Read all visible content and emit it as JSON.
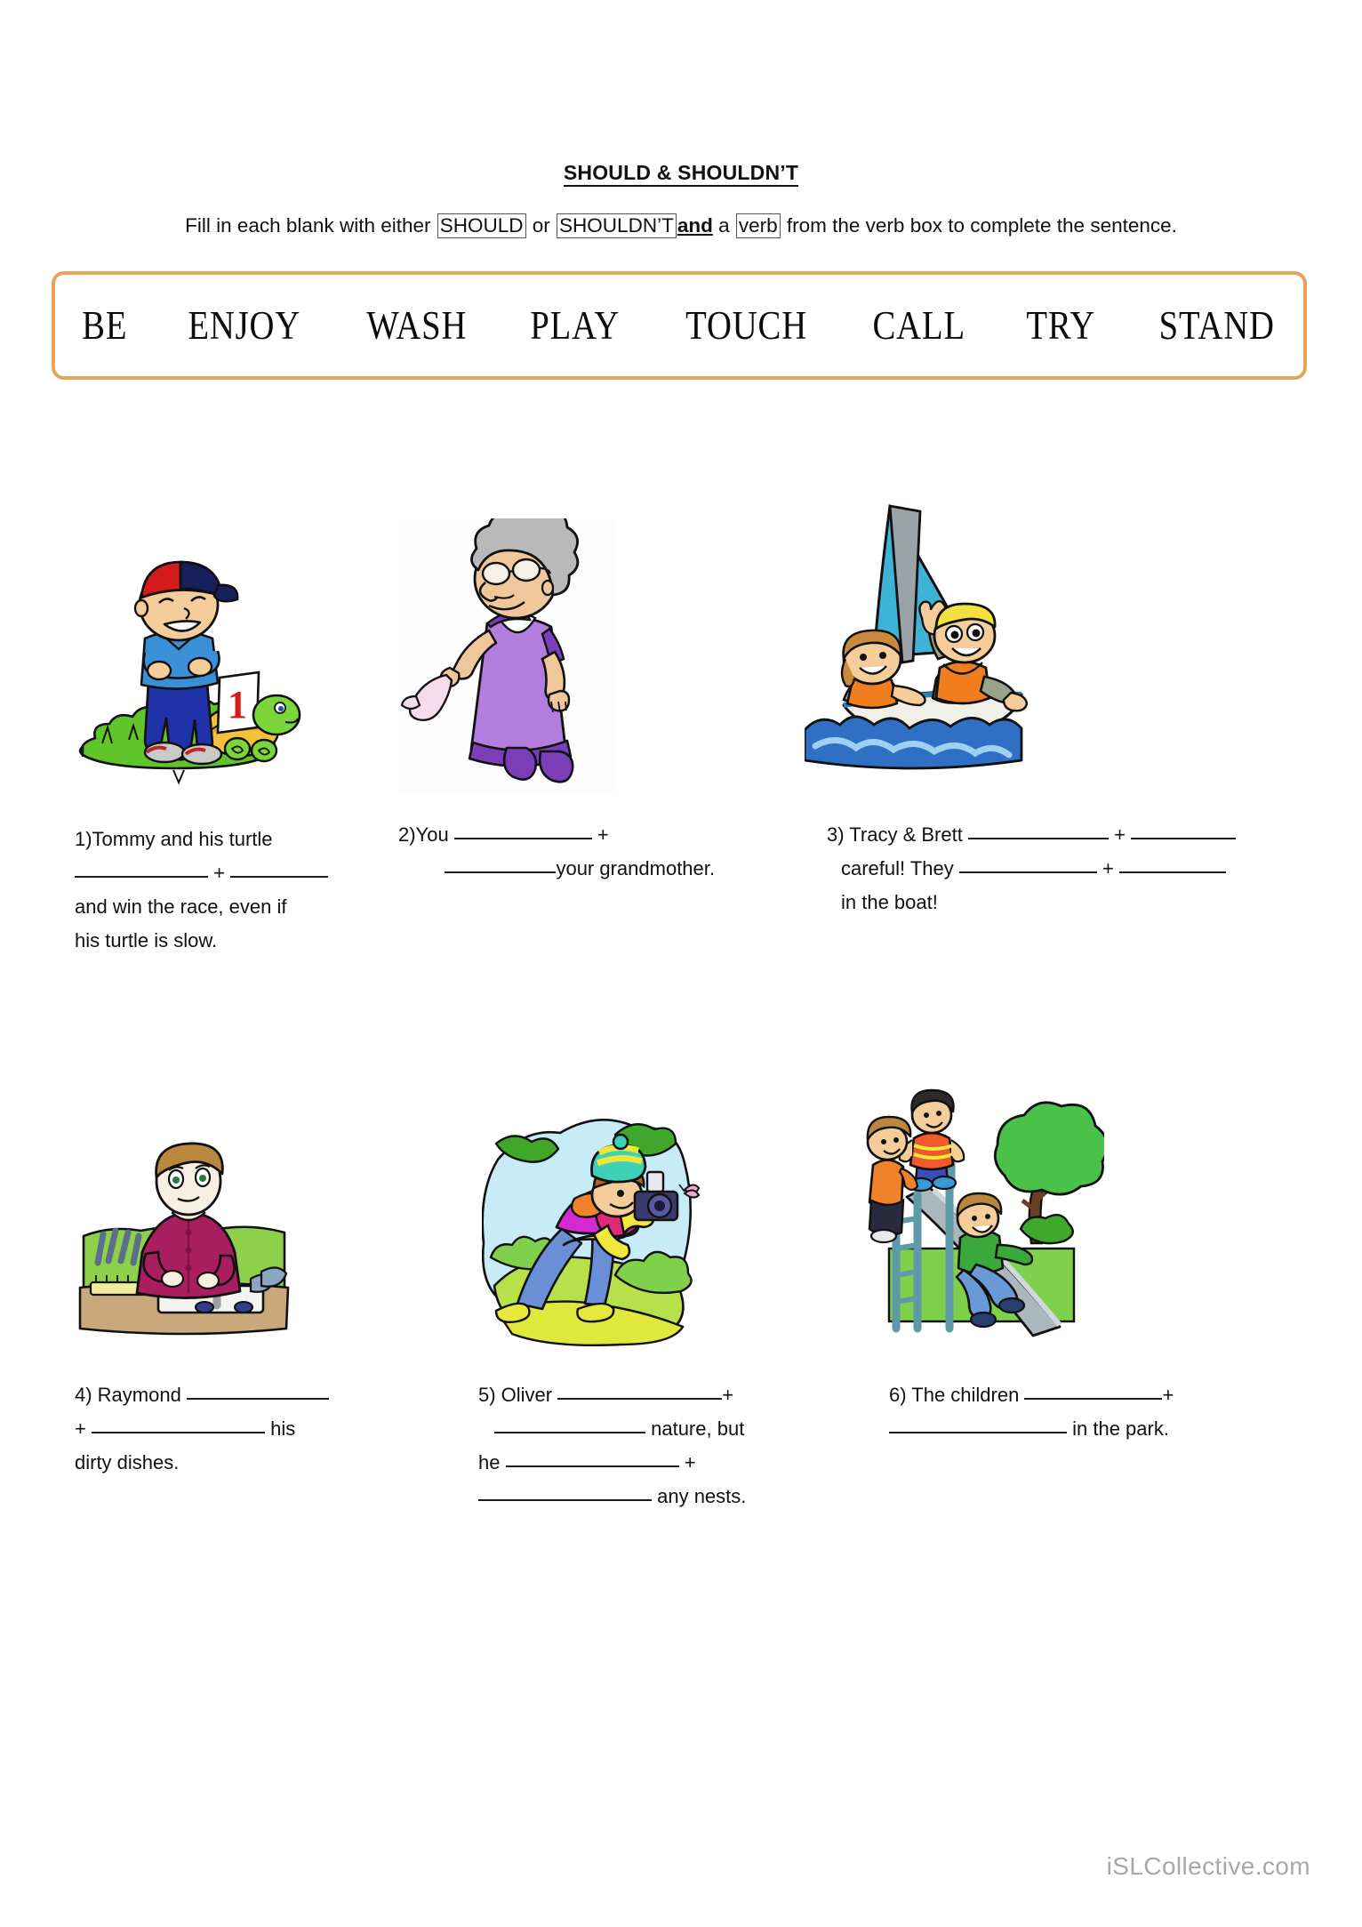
{
  "title": "SHOULD & SHOULDN’T",
  "instruction": {
    "part1": "Fill in each blank with either ",
    "box1": "SHOULD",
    "mid1": " or ",
    "box2": "SHOULDN’T",
    "and": "and",
    "mid2": " a ",
    "box3": "verb",
    "part2": " from the verb box to complete the sentence."
  },
  "verb_box": {
    "border_color": "#e8a25b",
    "verbs": [
      "BE",
      "ENJOY",
      "WASH",
      "PLAY",
      "TOUCH",
      "CALL",
      "TRY",
      "STAND"
    ]
  },
  "exercises": [
    {
      "number": "1)",
      "image_name": "boy-with-turtle-illustration",
      "line1_pre": "1)Tommy and his turtle",
      "line2_blank1_width": 150,
      "line2_plus": "+",
      "line2_blank2_width": 110,
      "line3": "and win the race, even if",
      "line4": "his turtle is slow."
    },
    {
      "number": "2)",
      "image_name": "grandmother-with-handkerchief-illustration",
      "line1_pre": "2)You ",
      "line1_blank_width": 155,
      "line1_post": " +",
      "line2_blank_width": 125,
      "line2_post": "your grandmother."
    },
    {
      "number": "3)",
      "image_name": "children-sailboat-illustration",
      "line1_pre": "3) Tracy & Brett ",
      "line1_blank1_width": 158,
      "line1_plus": "+",
      "line1_blank2_width": 118,
      "line2_pre": "careful! They ",
      "line2_blank1_width": 155,
      "line2_plus": "+",
      "line2_blank2_width": 120,
      "line3": "in the boat!"
    },
    {
      "number": "4)",
      "image_name": "boy-washing-dishes-illustration",
      "line1_pre": "4) Raymond ",
      "line1_blank_width": 160,
      "line2_plus": "+",
      "line2_blank_width": 195,
      "line2_post": " his",
      "line3": "dirty dishes."
    },
    {
      "number": "5)",
      "image_name": "photographer-nature-illustration",
      "line1_pre": "5) Oliver ",
      "line1_blank_width": 185,
      "line1_post": "+",
      "line2_blank_width": 170,
      "line2_post": " nature, but",
      "line3_pre": "he ",
      "line3_blank_width": 195,
      "line3_post": " +",
      "line4_blank_width": 195,
      "line4_post": " any nests."
    },
    {
      "number": "6)",
      "image_name": "children-playground-slide-illustration",
      "line1_pre": "6) The children ",
      "line1_blank_width": 155,
      "line1_post": "+",
      "line2_blank_width": 200,
      "line2_post": " in the park."
    }
  ],
  "watermark": "iSLCollective.com",
  "colors": {
    "verb_box_border": "#e8a25b",
    "text": "#111111",
    "watermark": "#a8a8a8",
    "blank_line": "#1c1c1c"
  }
}
